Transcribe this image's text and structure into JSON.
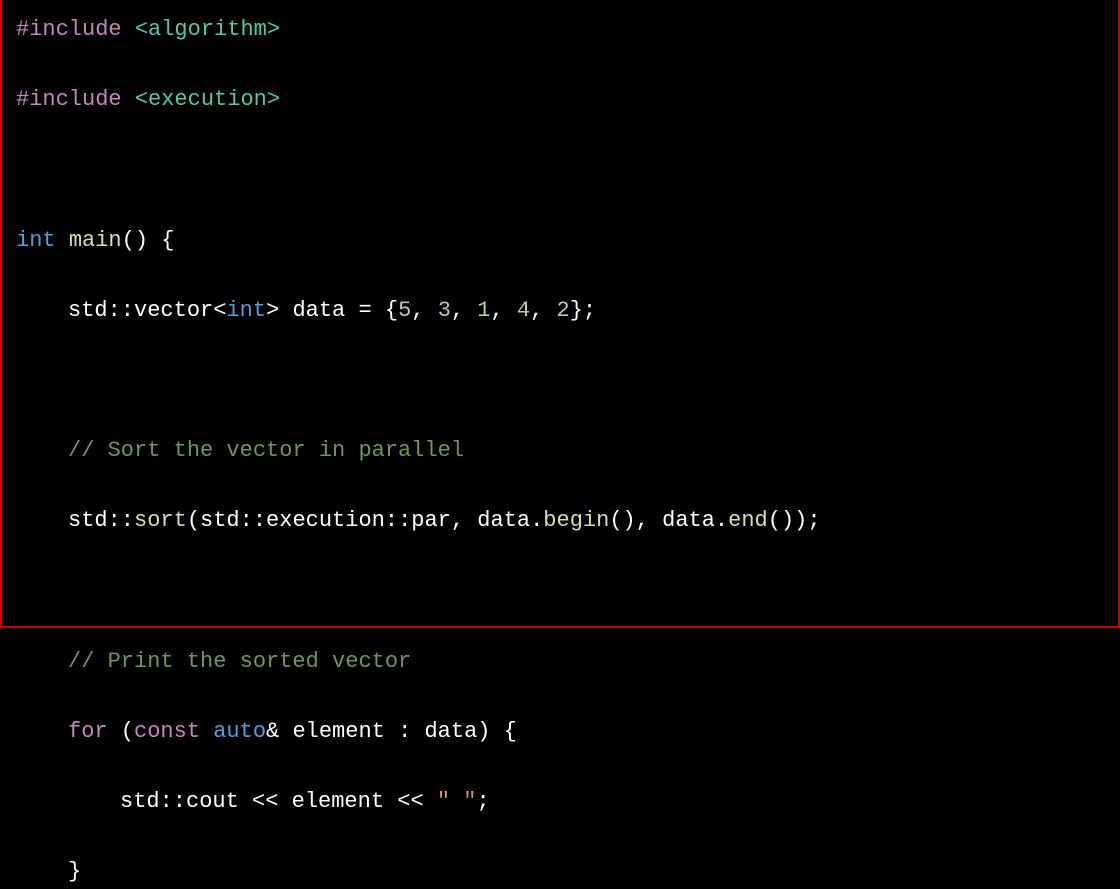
{
  "code": {
    "line1": {
      "pre": "#include ",
      "hdr": "<algorithm>"
    },
    "line2": {
      "pre": "#include ",
      "hdr": "<execution>"
    },
    "line4": {
      "kw1": "int",
      "sp1": " ",
      "fn": "main",
      "rest": "() {"
    },
    "line5": {
      "p1": "std::vector<",
      "kw": "int",
      "p2": "> data = {",
      "n1": "5",
      "c1": ", ",
      "n2": "3",
      "c2": ", ",
      "n3": "1",
      "c3": ", ",
      "n4": "4",
      "c4": ", ",
      "n5": "2",
      "p3": "};"
    },
    "line7": "// Sort the vector in parallel",
    "line8": {
      "p1": "std::",
      "fn1": "sort",
      "p2": "(std::execution::par, data.",
      "fn2": "begin",
      "p3": "(), data.",
      "fn3": "end",
      "p4": "());"
    },
    "line10": "// Print the sorted vector",
    "line11": {
      "kw1": "for",
      "p1": " (",
      "kw2": "const",
      "sp1": " ",
      "kw3": "auto",
      "p2": "& element : data) {"
    },
    "line12": {
      "p1": "std::cout << element << ",
      "str": "\" \"",
      "p2": ";"
    },
    "line13": "}"
  }
}
